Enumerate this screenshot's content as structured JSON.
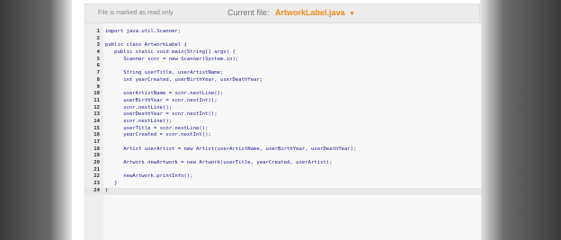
{
  "header": {
    "readonly_text": "File is marked as read only",
    "current_file_label": "Current file:",
    "current_file_name": "ArtworkLabel.java"
  },
  "editor": {
    "lines": [
      {
        "n": "1",
        "code": "import java.util.Scanner;"
      },
      {
        "n": "2",
        "code": ""
      },
      {
        "n": "3",
        "code": "public class ArtworkLabel {"
      },
      {
        "n": "4",
        "code": "   public static void main(String[] args) {"
      },
      {
        "n": "5",
        "code": "      Scanner scnr = new Scanner(System.in);"
      },
      {
        "n": "6",
        "code": ""
      },
      {
        "n": "7",
        "code": "      String userTitle, userArtistName;"
      },
      {
        "n": "8",
        "code": "      int yearCreated, userBirthYear, userDeathYear;"
      },
      {
        "n": "9",
        "code": ""
      },
      {
        "n": "10",
        "code": "      userArtistName = scnr.nextLine();"
      },
      {
        "n": "11",
        "code": "      userBirthYear = scnr.nextInt();"
      },
      {
        "n": "12",
        "code": "      scnr.nextLine();"
      },
      {
        "n": "13",
        "code": "      userDeathYear = scnr.nextInt();"
      },
      {
        "n": "14",
        "code": "      scnr.nextLine();"
      },
      {
        "n": "15",
        "code": "      userTitle = scnr.nextLine();"
      },
      {
        "n": "16",
        "code": "      yearCreated = scnr.nextInt();"
      },
      {
        "n": "17",
        "code": ""
      },
      {
        "n": "18",
        "code": "      Artist userArtist = new Artist(userArtistName, userBirthYear, userDeathYear);"
      },
      {
        "n": "19",
        "code": ""
      },
      {
        "n": "20",
        "code": "      Artwork newArtwork = new Artwork(userTitle, yearCreated, userArtist);"
      },
      {
        "n": "21",
        "code": ""
      },
      {
        "n": "22",
        "code": "      newArtwork.printInfo();"
      },
      {
        "n": "23",
        "code": "   }"
      },
      {
        "n": "24",
        "code": "}"
      }
    ],
    "active_line": "24"
  }
}
